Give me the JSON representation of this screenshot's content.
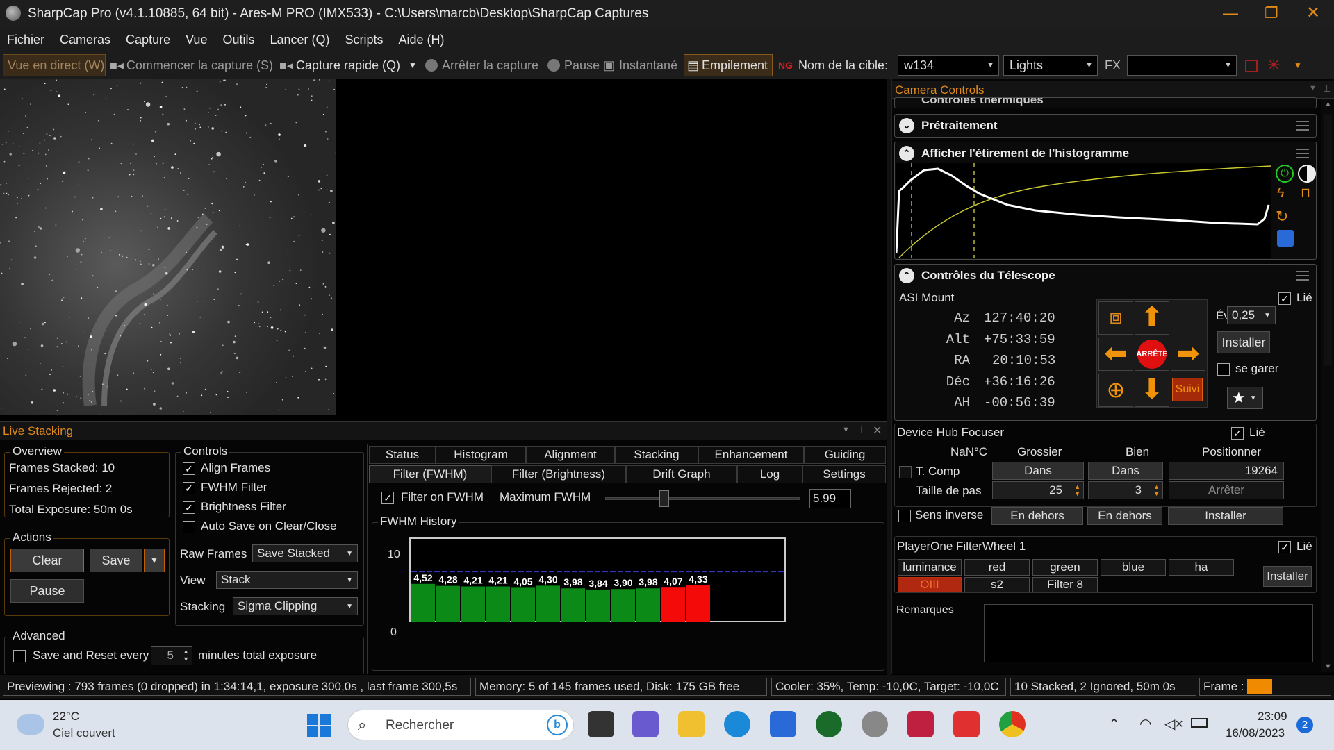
{
  "window": {
    "title": "SharpCap Pro (v4.1.10885, 64 bit) - Ares-M PRO (IMX533) - C:\\Users\\marcb\\Desktop\\SharpCap Captures"
  },
  "menu": [
    "Fichier",
    "Cameras",
    "Capture",
    "Vue",
    "Outils",
    "Lancer (Q)",
    "Scripts",
    "Aide (H)"
  ],
  "toolbar": {
    "live_view": "Vue en direct (W)",
    "start_capture": "Commencer la capture (S)",
    "quick_capture": "Capture rapide (Q)",
    "stop_capture": "Arrêter la capture",
    "pause": "Pause",
    "snapshot": "Instantané",
    "stacking": "Empilement",
    "target_label": "Nom de la cible:",
    "target_value": "w134",
    "frame_type": "Lights",
    "fx_label": "FX",
    "fx_value": ""
  },
  "camera_controls": {
    "title": "Camera Controls",
    "thermal": "Contrôles thermiques",
    "preprocessing": "Prétraitement",
    "histogram": "Afficher l'étirement de l'histogramme",
    "telescope": "Contrôles du Télescope",
    "mount": {
      "name": "ASI Mount",
      "linked": "Lié",
      "az_label": "Az",
      "az": "127:40:20",
      "alt_label": "Alt",
      "alt": "+75:33:59",
      "ra_label": "RA",
      "ra": "20:10:53",
      "dec_label": "Déc",
      "dec": "+36:16:26",
      "ah_label": "AH",
      "ah": "-00:56:39",
      "stop": "ARRÊTE",
      "rate_label": "Évaluer:",
      "rate": "0,25",
      "install": "Installer",
      "park": "se garer",
      "track": "Suivi"
    },
    "focuser": {
      "name": "Device Hub Focuser",
      "linked": "Lié",
      "temp": "NaN°C",
      "coarse": "Grossier",
      "fine": "Bien",
      "position": "Positionner",
      "tcomp": "T. Comp",
      "in": "Dans",
      "position_value": "19264",
      "step_label": "Taille de pas",
      "coarse_step": "25",
      "fine_step": "3",
      "stop": "Arrêter",
      "reverse": "Sens inverse",
      "out": "En dehors",
      "install": "Installer"
    },
    "filterwheel": {
      "name": "PlayerOne FilterWheel 1",
      "linked": "Lié",
      "filters": [
        "luminance",
        "red",
        "green",
        "blue",
        "ha",
        "OIII",
        "s2",
        "Filter 8"
      ],
      "active": "OIII",
      "install": "Installer"
    },
    "notes": "Remarques"
  },
  "live_stacking": {
    "title": "Live Stacking",
    "overview": {
      "title": "Overview",
      "frames_stacked": "Frames Stacked:  10",
      "frames_rejected": "Frames Rejected: 2",
      "total_exposure": "Total Exposure:    50m 0s"
    },
    "actions": {
      "title": "Actions",
      "clear": "Clear",
      "save": "Save",
      "pause": "Pause"
    },
    "controls": {
      "title": "Controls",
      "align": "Align Frames",
      "fwhm": "FWHM Filter",
      "brightness": "Brightness Filter",
      "autosave": "Auto Save on Clear/Close",
      "raw_label": "Raw Frames",
      "raw_value": "Save Stacked",
      "view_label": "View",
      "view_value": "Stack",
      "stacking_label": "Stacking",
      "stacking_value": "Sigma Clipping"
    },
    "advanced": {
      "title": "Advanced",
      "save_reset": "Save and Reset every",
      "minutes_value": "5",
      "minutes_label": "minutes total exposure"
    },
    "tabs_row1": [
      "Status",
      "Histogram",
      "Alignment",
      "Stacking",
      "Enhancement",
      "Guiding"
    ],
    "tabs_row2": [
      "Filter (FWHM)",
      "Filter (Brightness)",
      "Drift Graph",
      "Log",
      "Settings"
    ],
    "filter": {
      "enable": "Filter on FWHM",
      "max_label": "Maximum FWHM",
      "max_value": "5.99",
      "slider_value": 5.99,
      "history": "FWHM History"
    }
  },
  "chart_data": {
    "type": "bar",
    "title": "FWHM History",
    "ylim": [
      0,
      10
    ],
    "yticks": [
      "10",
      "0"
    ],
    "values": [
      4.52,
      4.28,
      4.21,
      4.21,
      4.05,
      4.3,
      3.98,
      3.84,
      3.9,
      3.98,
      4.07,
      4.33
    ],
    "labels": [
      "4,52",
      "4,28",
      "4,21",
      "4,21",
      "4,05",
      "4,30",
      "3,98",
      "3,84",
      "3,90",
      "3,98",
      "4,07",
      "4,33"
    ],
    "threshold": 5.99,
    "colors": {
      "accepted": "#0b8a17",
      "rejected": "#f50a0a",
      "threshold": "#3a3ad8"
    },
    "rejected_index": [
      10,
      11
    ]
  },
  "status": {
    "preview": "Previewing : 793 frames (0 dropped) in 1:34:14,1, exposure 300,0s , last frame 300,5s",
    "memory": "Memory: 5 of 145 frames used, Disk: 175 GB free",
    "cooler": "Cooler: 35%, Temp: -10,0C, Target: -10,0C",
    "stacked": "10 Stacked, 2 Ignored, 50m 0s",
    "frame": "Frame :"
  },
  "taskbar": {
    "temp": "22°C",
    "weather": "Ciel couvert",
    "search": "Rechercher",
    "time": "23:09",
    "date": "16/08/2023",
    "notif": "2"
  }
}
